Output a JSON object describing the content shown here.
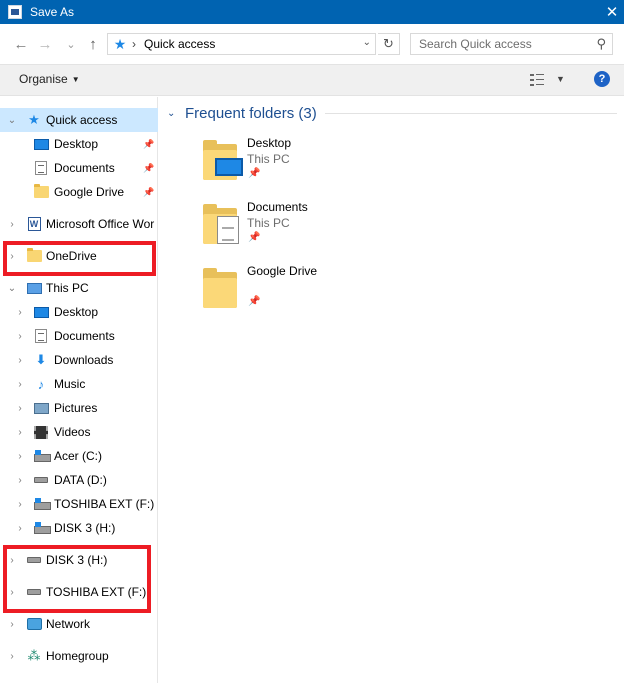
{
  "window": {
    "title": "Save As",
    "close_glyph": "✕"
  },
  "toolbar": {
    "back_glyph": "←",
    "forward_glyph": "→",
    "recent_glyph": "⌄",
    "up_glyph": "↑",
    "address": {
      "location_icon": "quick-access-star-icon",
      "separator": "›",
      "crumb": "Quick access"
    },
    "search": {
      "placeholder": "Search Quick access"
    }
  },
  "commandbar": {
    "organise_label": "Organise",
    "help_label": "?"
  },
  "sidebar": {
    "items": [
      {
        "label": "Quick access",
        "icon": "star",
        "expanded": true,
        "selected": true
      },
      {
        "label": "Desktop",
        "icon": "desktop",
        "pinned": true
      },
      {
        "label": "Documents",
        "icon": "documents",
        "pinned": true
      },
      {
        "label": "Google Drive",
        "icon": "folder",
        "pinned": true
      },
      {
        "label": "Microsoft Office Wor",
        "icon": "word"
      },
      {
        "label": "OneDrive",
        "icon": "folder"
      },
      {
        "label": "This PC",
        "icon": "pc",
        "expanded": true
      },
      {
        "label": "Desktop",
        "icon": "desktop"
      },
      {
        "label": "Documents",
        "icon": "documents"
      },
      {
        "label": "Downloads",
        "icon": "downloads"
      },
      {
        "label": "Music",
        "icon": "music"
      },
      {
        "label": "Pictures",
        "icon": "pictures"
      },
      {
        "label": "Videos",
        "icon": "videos"
      },
      {
        "label": "Acer (C:)",
        "icon": "system-drive"
      },
      {
        "label": "DATA (D:)",
        "icon": "drive"
      },
      {
        "label": "TOSHIBA EXT (F:)",
        "icon": "usb-drive"
      },
      {
        "label": "DISK 3 (H:)",
        "icon": "usb-drive"
      },
      {
        "label": "DISK 3 (H:)",
        "icon": "drive"
      },
      {
        "label": "TOSHIBA EXT (F:)",
        "icon": "drive"
      },
      {
        "label": "Network",
        "icon": "network"
      },
      {
        "label": "Homegroup",
        "icon": "homegroup"
      }
    ]
  },
  "content": {
    "group_title": "Frequent folders (3)",
    "folders": [
      {
        "name": "Desktop",
        "location": "This PC",
        "pinned": true
      },
      {
        "name": "Documents",
        "location": "This PC",
        "pinned": true
      },
      {
        "name": "Google Drive",
        "location": "",
        "pinned": true
      }
    ]
  },
  "glyphs": {
    "chevron_right": "›",
    "chevron_down": "⌄",
    "pin": "📌"
  },
  "colors": {
    "titlebar": "#0063b1",
    "selection": "#cce8ff",
    "highlight_box": "#ed1c24",
    "group_title": "#1e4f91"
  }
}
